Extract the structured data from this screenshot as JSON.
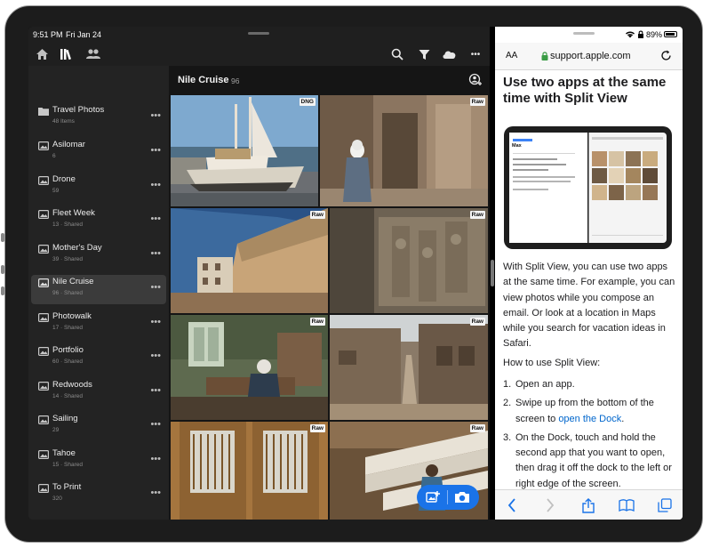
{
  "status_bar": {
    "time": "9:51 PM",
    "date": "Fri Jan 24",
    "battery": "89%"
  },
  "lightroom": {
    "sidebar": {
      "albums": [
        {
          "title": "Travel Photos",
          "subtitle": "48 Items",
          "icon": "folder-icon"
        },
        {
          "title": "Asilomar",
          "subtitle": "6",
          "icon": "album-icon"
        },
        {
          "title": "Drone",
          "subtitle": "59",
          "icon": "album-icon"
        },
        {
          "title": "Fleet Week",
          "subtitle": "13 · Shared",
          "icon": "album-icon"
        },
        {
          "title": "Mother's Day",
          "subtitle": "39 · Shared",
          "icon": "album-icon"
        },
        {
          "title": "Nile Cruise",
          "subtitle": "96 · Shared",
          "icon": "album-icon",
          "selected": true
        },
        {
          "title": "Photowalk",
          "subtitle": "17 · Shared",
          "icon": "album-icon"
        },
        {
          "title": "Portfolio",
          "subtitle": "60 · Shared",
          "icon": "album-icon"
        },
        {
          "title": "Redwoods",
          "subtitle": "14 · Shared",
          "icon": "album-icon"
        },
        {
          "title": "Sailing",
          "subtitle": "29",
          "icon": "album-icon"
        },
        {
          "title": "Tahoe",
          "subtitle": "15 · Shared",
          "icon": "album-icon"
        },
        {
          "title": "To Print",
          "subtitle": "320",
          "icon": "album-icon"
        }
      ],
      "more_glyph": "•••"
    },
    "album": {
      "title": "Nile Cruise",
      "count": "96"
    },
    "photos": [
      {
        "badge": "DNG"
      },
      {
        "badge": "Raw"
      },
      {
        "badge": "Raw"
      },
      {
        "badge": "Raw"
      },
      {
        "badge": "Raw"
      },
      {
        "badge": "Raw"
      },
      {
        "badge": "Raw"
      },
      {
        "badge": "Raw"
      }
    ],
    "toolbar_more": "•••"
  },
  "safari": {
    "text_size_label": "AA",
    "url": "support.apple.com",
    "article": {
      "title": "Use two apps at the same time with Split View",
      "body": "With Split View, you can use two apps at the same time. For example, you can view photos while you compose an email. Or look at a location in Maps while you search for vacation ideas in Safari.",
      "how_to": "How to use Split View:",
      "steps": [
        {
          "num": "1.",
          "text": "Open an app."
        },
        {
          "num": "2.",
          "text": "Swipe up from the bottom of the screen to ",
          "link": "open the Dock",
          "after": "."
        },
        {
          "num": "3.",
          "text": "On the Dock, touch and hold the second app that you want to open, then drag it off the dock to the left or right edge of the screen."
        }
      ],
      "mock": {
        "sender": "Max"
      }
    }
  },
  "colors": {
    "accent_blue": "#1a73e8",
    "link_blue": "#0066cc",
    "dark_bg": "#1f1f1f"
  }
}
